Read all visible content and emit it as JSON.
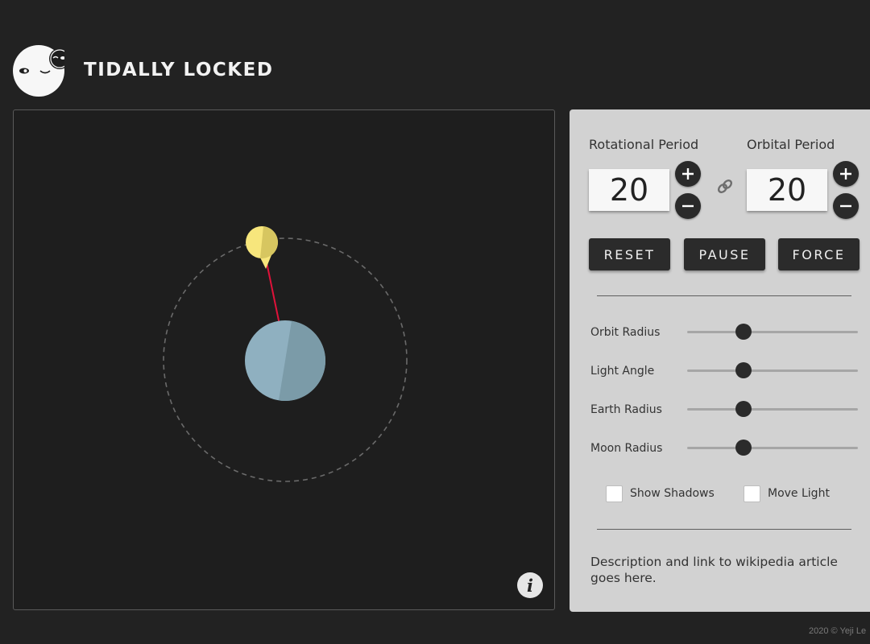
{
  "header": {
    "title": "TIDALLY LOCKED"
  },
  "periods": {
    "rotational_label": "Rotational Period",
    "rotational_value": "20",
    "orbital_label": "Orbital Period",
    "orbital_value": "20"
  },
  "actions": {
    "reset_label": "RESET",
    "pause_label": "PAUSE",
    "force_label": "FORCE"
  },
  "sliders": [
    {
      "label": "Orbit Radius",
      "level": 0.33
    },
    {
      "label": "Light Angle",
      "level": 0.33
    },
    {
      "label": "Earth Radius",
      "level": 0.33
    },
    {
      "label": "Moon Radius",
      "level": 0.33
    }
  ],
  "checkboxes": {
    "shadows_label": "Show Shadows",
    "shadows_checked": false,
    "move_light_label": "Move Light",
    "move_light_checked": false
  },
  "description": "Description and link to wikipedia article goes here.",
  "footer": "2020 © Yeji Le",
  "colors": {
    "background": "#222222",
    "panel": "#d2d2d2",
    "earth": "#8fb0c0",
    "earth_shade": "#7b9ba8",
    "moon": "#f7e67c",
    "tether": "#e0123a",
    "button": "#2b2b2b"
  },
  "icons": {
    "logo": "winking-moon-logo",
    "link": "chain-link-icon",
    "info": "info-icon",
    "plus": "plus-icon",
    "minus": "minus-icon"
  }
}
